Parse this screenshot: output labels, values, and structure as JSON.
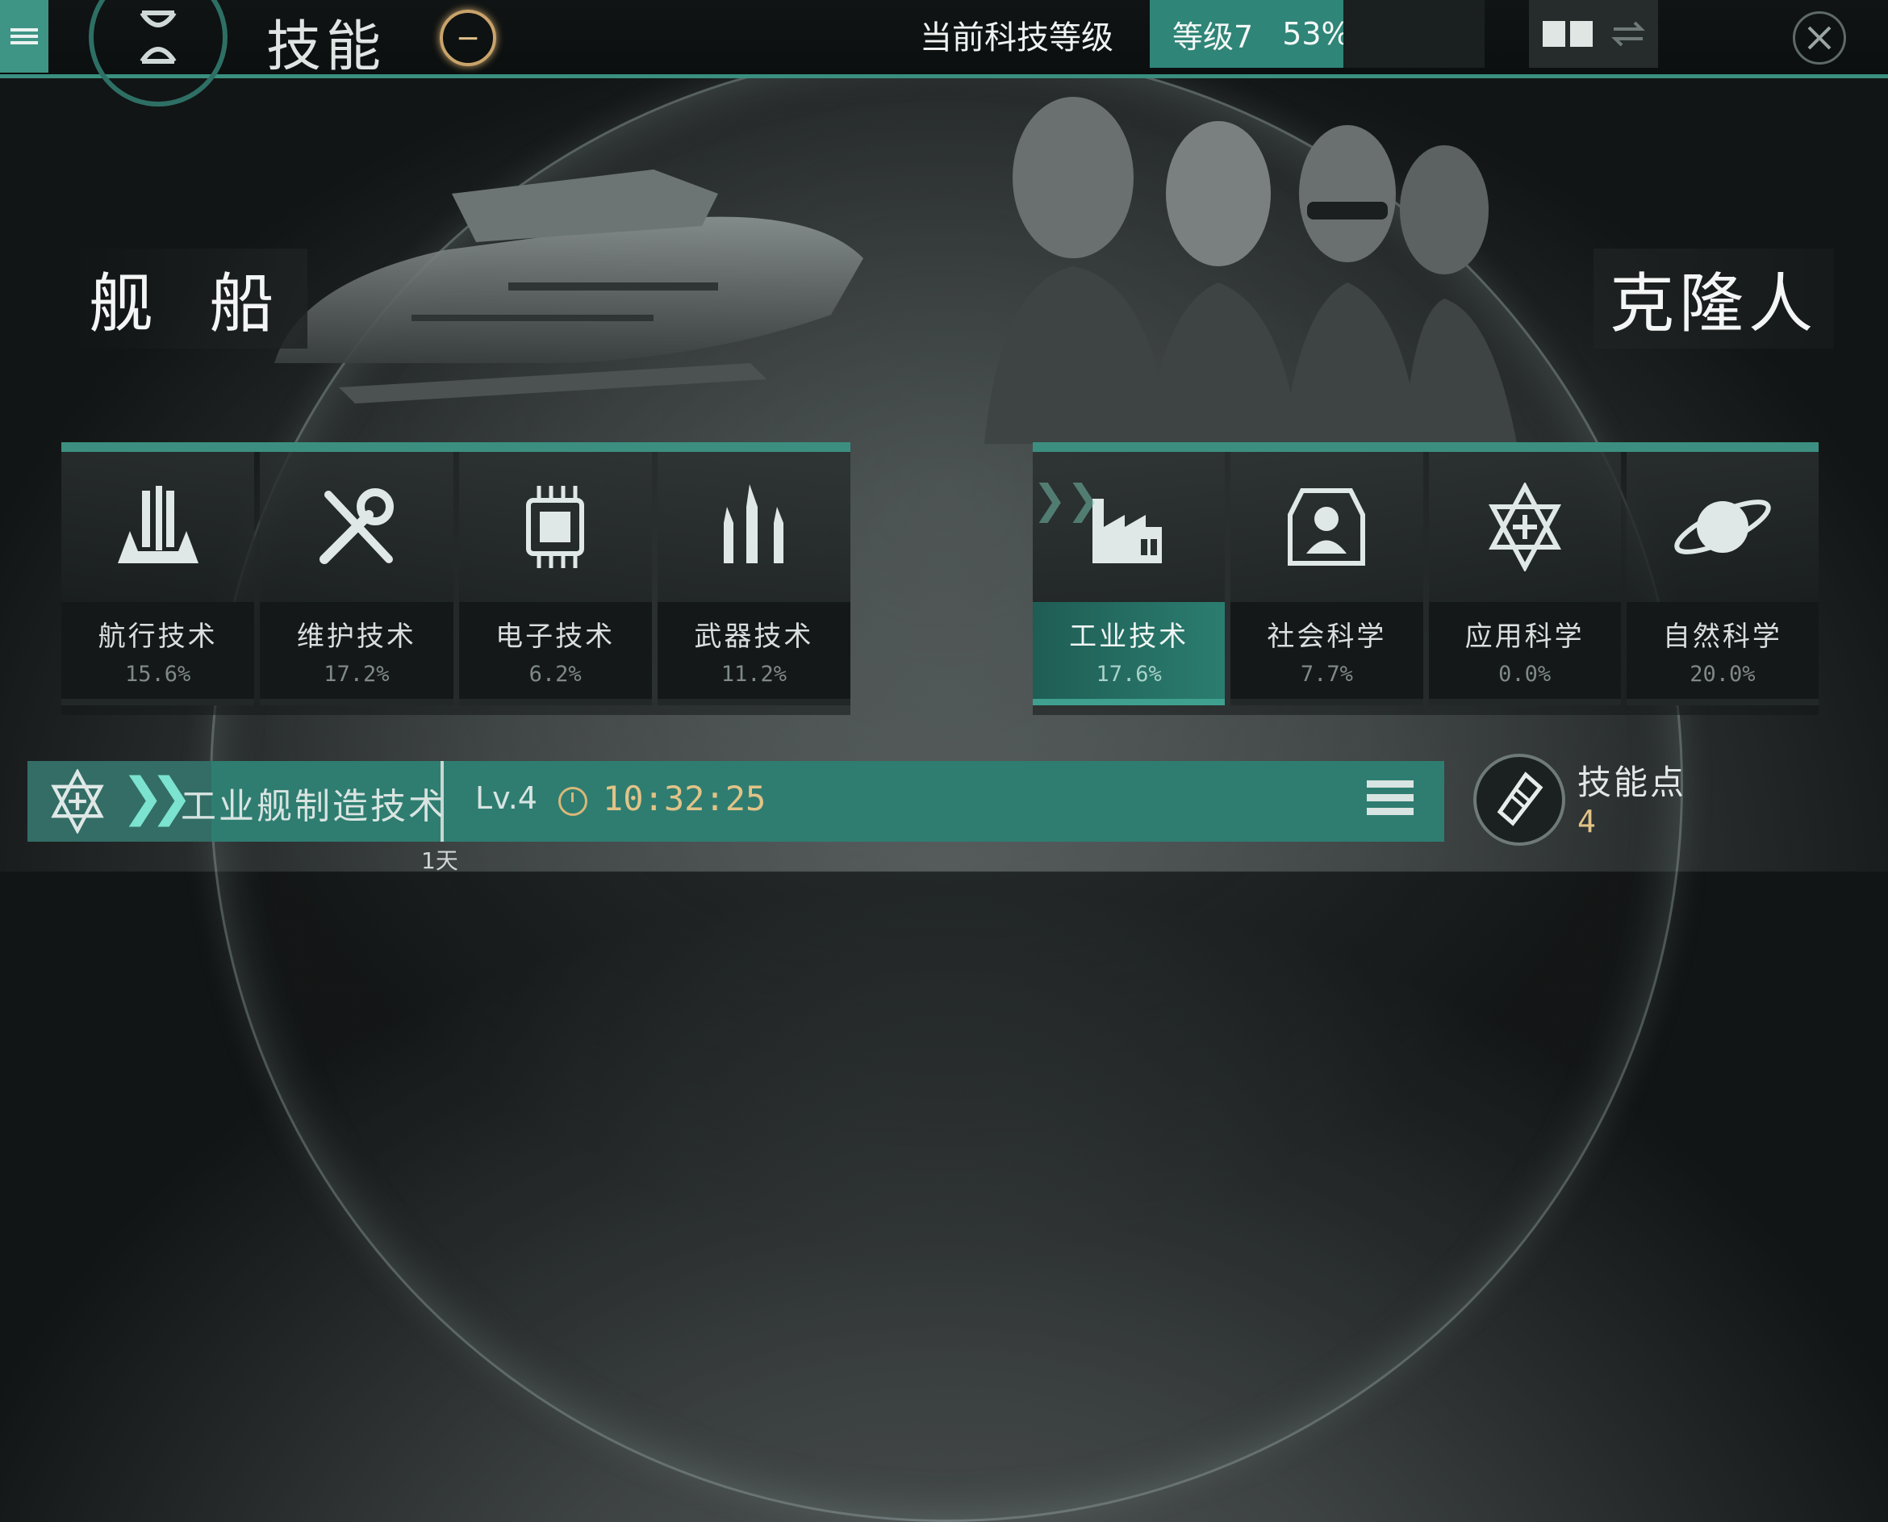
{
  "header": {
    "title": "技能",
    "title_badge": "−",
    "tech_level_label": "当前科技等级",
    "tech_level_value": "等级7",
    "tech_level_progress": "53%",
    "tech_level_fraction": 0.53
  },
  "sections": {
    "ship_label": "舰 船",
    "clone_label": "克隆人"
  },
  "ship_skills": [
    {
      "name": "航行技术",
      "percent": "15.6%",
      "icon": "ship-icon"
    },
    {
      "name": "维护技术",
      "percent": "17.2%",
      "icon": "wrench-screwdriver-icon"
    },
    {
      "name": "电子技术",
      "percent": "6.2%",
      "icon": "chip-icon"
    },
    {
      "name": "武器技术",
      "percent": "11.2%",
      "icon": "missiles-icon"
    }
  ],
  "clone_skills": [
    {
      "name": "工业技术",
      "percent": "17.6%",
      "icon": "factory-icon",
      "active": true
    },
    {
      "name": "社会科学",
      "percent": "7.7%",
      "icon": "person-icon"
    },
    {
      "name": "应用科学",
      "percent": "0.0%",
      "icon": "atom-star-icon"
    },
    {
      "name": "自然科学",
      "percent": "20.0%",
      "icon": "planet-icon"
    }
  ],
  "research": {
    "name": "工业舰制造技术",
    "level": "Lv.4",
    "time": "10:32:25",
    "day_marker": "1天",
    "progress_fraction": 0.13
  },
  "skill_points": {
    "label": "技能点",
    "value": "4"
  },
  "colors": {
    "accent": "#3c8f80",
    "gold": "#e2c387"
  }
}
